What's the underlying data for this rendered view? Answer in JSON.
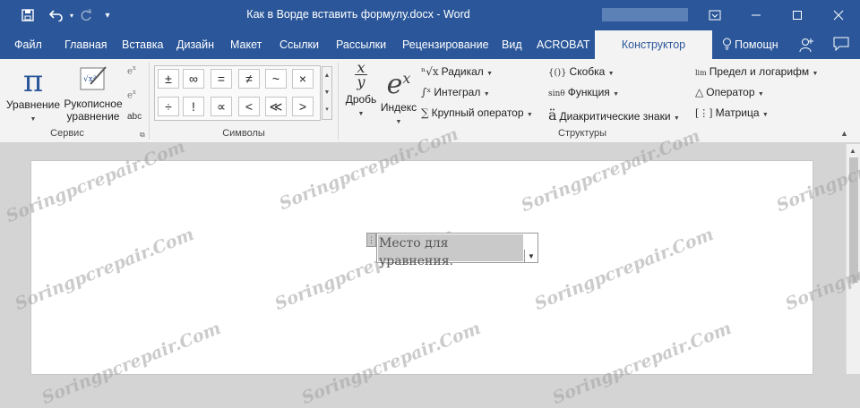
{
  "title_bar": {
    "document_title": "Как в Ворде вставить формулу.docx - Word"
  },
  "tabs": [
    {
      "label": "Файл"
    },
    {
      "label": "Главная"
    },
    {
      "label": "Вставка"
    },
    {
      "label": "Дизайн"
    },
    {
      "label": "Макет"
    },
    {
      "label": "Ссылки"
    },
    {
      "label": "Рассылки"
    },
    {
      "label": "Рецензирование"
    },
    {
      "label": "Вид"
    },
    {
      "label": "ACROBAT"
    },
    {
      "label": "Конструктор",
      "active": true
    }
  ],
  "tellme": {
    "label": "Помощн"
  },
  "groups": {
    "service": {
      "label": "Сервис",
      "equation_label": "Уравнение",
      "ink_label_1": "Рукописное",
      "ink_label_2": "уравнение",
      "abc": "abc"
    },
    "symbols": {
      "label": "Символы",
      "items": [
        "±",
        "∞",
        "=",
        "≠",
        "~",
        "×",
        "÷",
        "!",
        "∝",
        "<",
        "≪",
        ">"
      ]
    },
    "structures": {
      "label": "Структуры",
      "fraction_label": "Дробь",
      "script_label": "Индекс",
      "radical": "Радикал",
      "integral": "Интеграл",
      "large_operator": "Крупный оператор",
      "bracket": "Скобка",
      "function": "Функция",
      "accent": "Диакритические знаки",
      "limit_log": "Предел и логарифм",
      "operator": "Оператор",
      "matrix": "Матрица"
    }
  },
  "document": {
    "equation_placeholder": "Место для уравнения."
  },
  "watermark_text": "Soringpcrepair.Com"
}
